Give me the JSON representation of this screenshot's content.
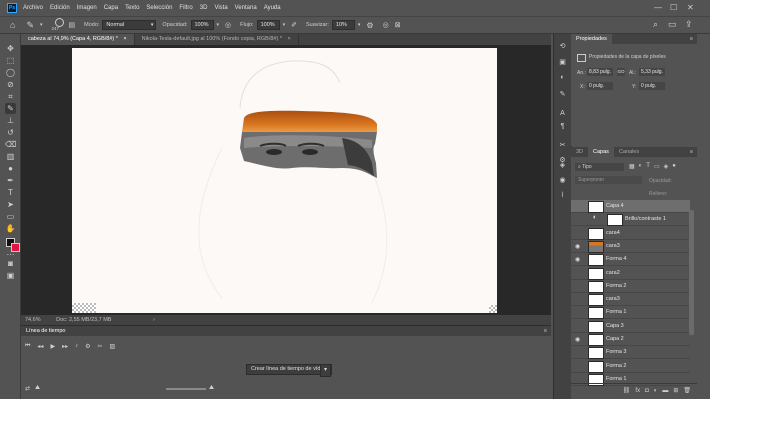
{
  "menu": {
    "logo": "Ps",
    "items": [
      "Archivo",
      "Edición",
      "Imagen",
      "Capa",
      "Texto",
      "Selección",
      "Filtro",
      "3D",
      "Vista",
      "Ventana",
      "Ayuda"
    ]
  },
  "window_controls": {
    "minimize": "—",
    "maximize": "☐",
    "close": "✕"
  },
  "options": {
    "brush_size": "247",
    "mode_label": "Modo:",
    "mode_value": "Normal",
    "opacity_label": "Opacidad:",
    "opacity_value": "100%",
    "flow_label": "Flujo:",
    "flow_value": "100%",
    "smoothing_label": "Suavizar:",
    "smoothing_value": "10%"
  },
  "tabs": [
    {
      "label": "cabeza al 74,9% (Capa 4, RGB/8#) *",
      "close": "×"
    },
    {
      "label": "Nikola-Tesla-default.jpg al 100% (Fondo copia, RGB/8#) *",
      "close": "×"
    }
  ],
  "status": {
    "zoom": "74,6%",
    "doc": "Doc: 2,55 MB/23,7 MB"
  },
  "timeline": {
    "title": "Línea de tiempo",
    "create_button": "Crear línea de tiempo de vídeo"
  },
  "properties": {
    "tab_label": "Propiedades",
    "subtitle": "Propiedades de la capa de píxeles",
    "w_label": "An.:",
    "w_value": "8,83 pulg.",
    "link_icon": "GO",
    "h_label": "Al.:",
    "h_value": "5,33 pulg.",
    "x_label": "X:",
    "x_value": "0 pulg.",
    "y_label": "Y:",
    "y_value": "0 pulg."
  },
  "layers_panel": {
    "tabs": [
      "3D",
      "Capas",
      "Canales"
    ],
    "filter_value": "Tipo",
    "blend_value": "Superponer",
    "opacity_label": "Opacidad:",
    "fill_label": "Relleno:",
    "layers": [
      {
        "name": "Capa 4",
        "visible": false,
        "thumb": "plain",
        "selected": true
      },
      {
        "name": "Brillo/contraste 1",
        "visible": false,
        "thumb": "adjust",
        "selected": false
      },
      {
        "name": "cara4",
        "visible": false,
        "thumb": "checker",
        "selected": false
      },
      {
        "name": "cara3",
        "visible": true,
        "thumb": "face",
        "selected": false
      },
      {
        "name": "Forma 4",
        "visible": true,
        "thumb": "checker",
        "selected": false
      },
      {
        "name": "cara2",
        "visible": false,
        "thumb": "checker",
        "selected": false
      },
      {
        "name": "Forma 2",
        "visible": false,
        "thumb": "checker",
        "selected": false
      },
      {
        "name": "cara3",
        "visible": false,
        "thumb": "checker",
        "selected": false
      },
      {
        "name": "Forma 1",
        "visible": false,
        "thumb": "checker",
        "selected": false
      },
      {
        "name": "Capa 3",
        "visible": false,
        "thumb": "checker",
        "selected": false
      },
      {
        "name": "Capa 2",
        "visible": true,
        "thumb": "plain",
        "selected": false
      },
      {
        "name": "Forma 3",
        "visible": false,
        "thumb": "checker",
        "selected": false
      },
      {
        "name": "Forma 2",
        "visible": false,
        "thumb": "checker",
        "selected": false
      },
      {
        "name": "Forma 1",
        "visible": false,
        "thumb": "checker",
        "selected": false
      }
    ]
  }
}
